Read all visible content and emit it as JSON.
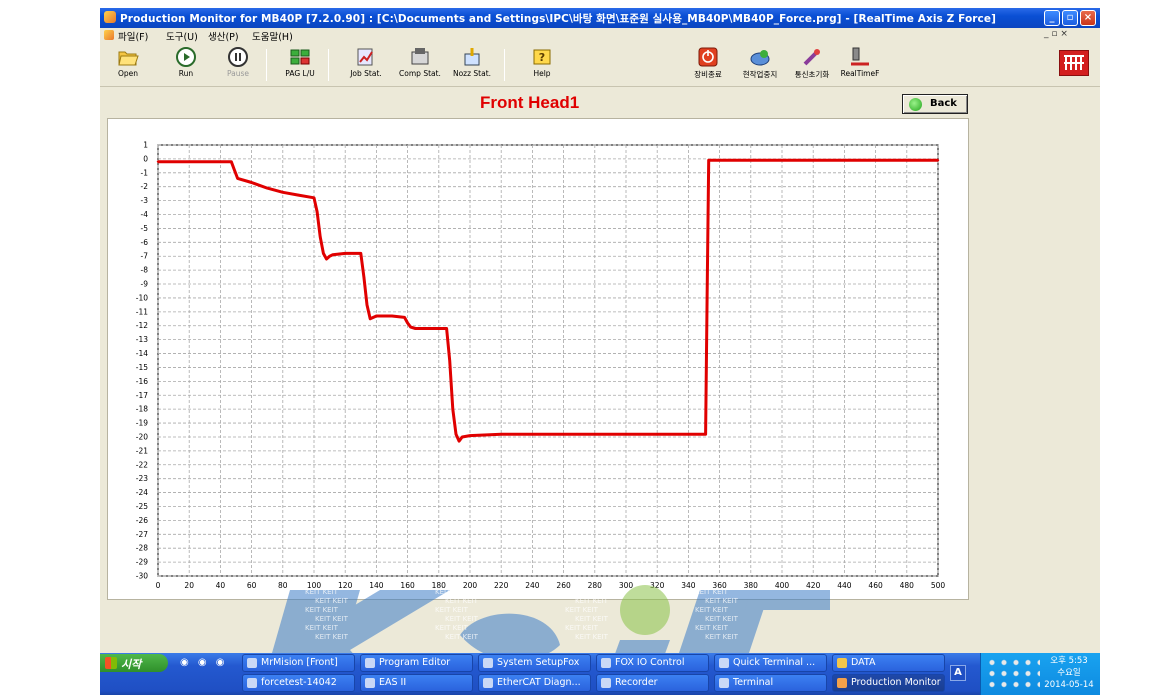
{
  "window": {
    "title": "Production Monitor for MB40P [7.2.0.90] : [C:\\Documents and Settings\\IPC\\바탕 화면\\표준원 실사용_MB40P\\MB40P_Force.prg] - [RealTime Axis Z Force]",
    "controls": [
      "_",
      "▫",
      "×"
    ]
  },
  "menu": {
    "items": [
      "파일(F)",
      "도구(U)",
      "생산(P)",
      "도움말(H)"
    ],
    "mdi_controls": "_ ▫ ×"
  },
  "toolbar": {
    "buttons": [
      {
        "label": "Open",
        "icon": "folder-open-icon"
      },
      {
        "label": "Run",
        "icon": "play-icon"
      },
      {
        "label": "Pause",
        "icon": "pause-icon",
        "disabled": true
      },
      {
        "label": "PAG L/U",
        "icon": "pcb-icon"
      },
      {
        "label": "Job Stat.",
        "icon": "job-stat-icon"
      },
      {
        "label": "Comp Stat.",
        "icon": "comp-stat-icon"
      },
      {
        "label": "Nozz Stat.",
        "icon": "nozzle-stat-icon"
      },
      {
        "label": "Help",
        "icon": "help-icon"
      },
      {
        "label": "장비종료",
        "icon": "power-icon"
      },
      {
        "label": "현작업중지",
        "icon": "stop-job-icon"
      },
      {
        "label": "통신초기화",
        "icon": "comm-reset-icon"
      },
      {
        "label": "RealTimeF",
        "icon": "realtime-force-icon"
      }
    ]
  },
  "chart_title": "Front Head1",
  "back_button": "Back",
  "chart_data": {
    "type": "line",
    "title": "Front Head1",
    "xlim": [
      0,
      500
    ],
    "ylim": [
      -30,
      1
    ],
    "x_ticks": [
      0,
      20,
      40,
      60,
      80,
      100,
      120,
      140,
      160,
      180,
      200,
      220,
      240,
      260,
      280,
      300,
      320,
      340,
      360,
      380,
      400,
      420,
      440,
      460,
      480,
      500
    ],
    "y_ticks": [
      1,
      0,
      -1,
      -2,
      -3,
      -4,
      -5,
      -6,
      -7,
      -8,
      -9,
      -10,
      -11,
      -12,
      -13,
      -14,
      -15,
      -16,
      -17,
      -18,
      -19,
      -20,
      -21,
      -22,
      -23,
      -24,
      -25,
      -26,
      -27,
      -28,
      -29,
      -30
    ],
    "grid": true,
    "series": [
      {
        "color": "#e00000",
        "x": [
          0,
          47,
          49,
          51,
          60,
          70,
          80,
          90,
          100,
          102,
          104,
          106,
          108,
          110,
          112,
          120,
          130,
          132,
          134,
          136,
          138,
          140,
          150,
          158,
          160,
          162,
          165,
          180,
          185,
          187,
          189,
          191,
          193,
          195,
          200,
          220,
          240,
          260,
          280,
          300,
          320,
          340,
          351,
          352,
          353,
          360,
          380,
          400,
          420,
          440,
          460,
          480,
          500
        ],
        "y": [
          -0.2,
          -0.2,
          -0.8,
          -1.4,
          -1.7,
          -2.1,
          -2.4,
          -2.6,
          -2.8,
          -3.8,
          -5.6,
          -6.8,
          -7.2,
          -7.0,
          -6.9,
          -6.8,
          -6.8,
          -8.5,
          -10.5,
          -11.5,
          -11.4,
          -11.3,
          -11.3,
          -11.4,
          -11.8,
          -12.1,
          -12.2,
          -12.2,
          -12.2,
          -14.5,
          -18.0,
          -19.8,
          -20.3,
          -20.0,
          -19.9,
          -19.8,
          -19.8,
          -19.8,
          -19.8,
          -19.8,
          -19.8,
          -19.8,
          -19.8,
          -10.0,
          -0.1,
          -0.1,
          -0.1,
          -0.1,
          -0.1,
          -0.1,
          -0.1,
          -0.1,
          -0.1
        ]
      }
    ]
  },
  "taskbar": {
    "start_label": "시작",
    "items_row1": [
      {
        "label": "MrMision [Front]",
        "icon": "app-icon"
      },
      {
        "label": "Program Editor",
        "icon": "app-icon"
      },
      {
        "label": "System SetupFox",
        "icon": "app-icon"
      },
      {
        "label": "FOX IO Control",
        "icon": "app-icon"
      },
      {
        "label": "Quick Terminal ...",
        "icon": "app-icon"
      },
      {
        "label": "DATA",
        "icon": "folder-icon"
      }
    ],
    "items_row2": [
      {
        "label": "forcetest-14042",
        "icon": "app-icon"
      },
      {
        "label": "EAS II",
        "icon": "app-icon"
      },
      {
        "label": "EtherCAT Diagn...",
        "icon": "app-icon"
      },
      {
        "label": "Recorder",
        "icon": "app-icon"
      },
      {
        "label": "Terminal",
        "icon": "app-icon"
      },
      {
        "label": "Production Monitor",
        "icon": "app-icon",
        "active": true
      }
    ],
    "language": "A",
    "clock_line1": "오후 5:53",
    "clock_line2": "수요일",
    "clock_line3": "2014-05-14"
  },
  "watermark_text": "KEIT"
}
